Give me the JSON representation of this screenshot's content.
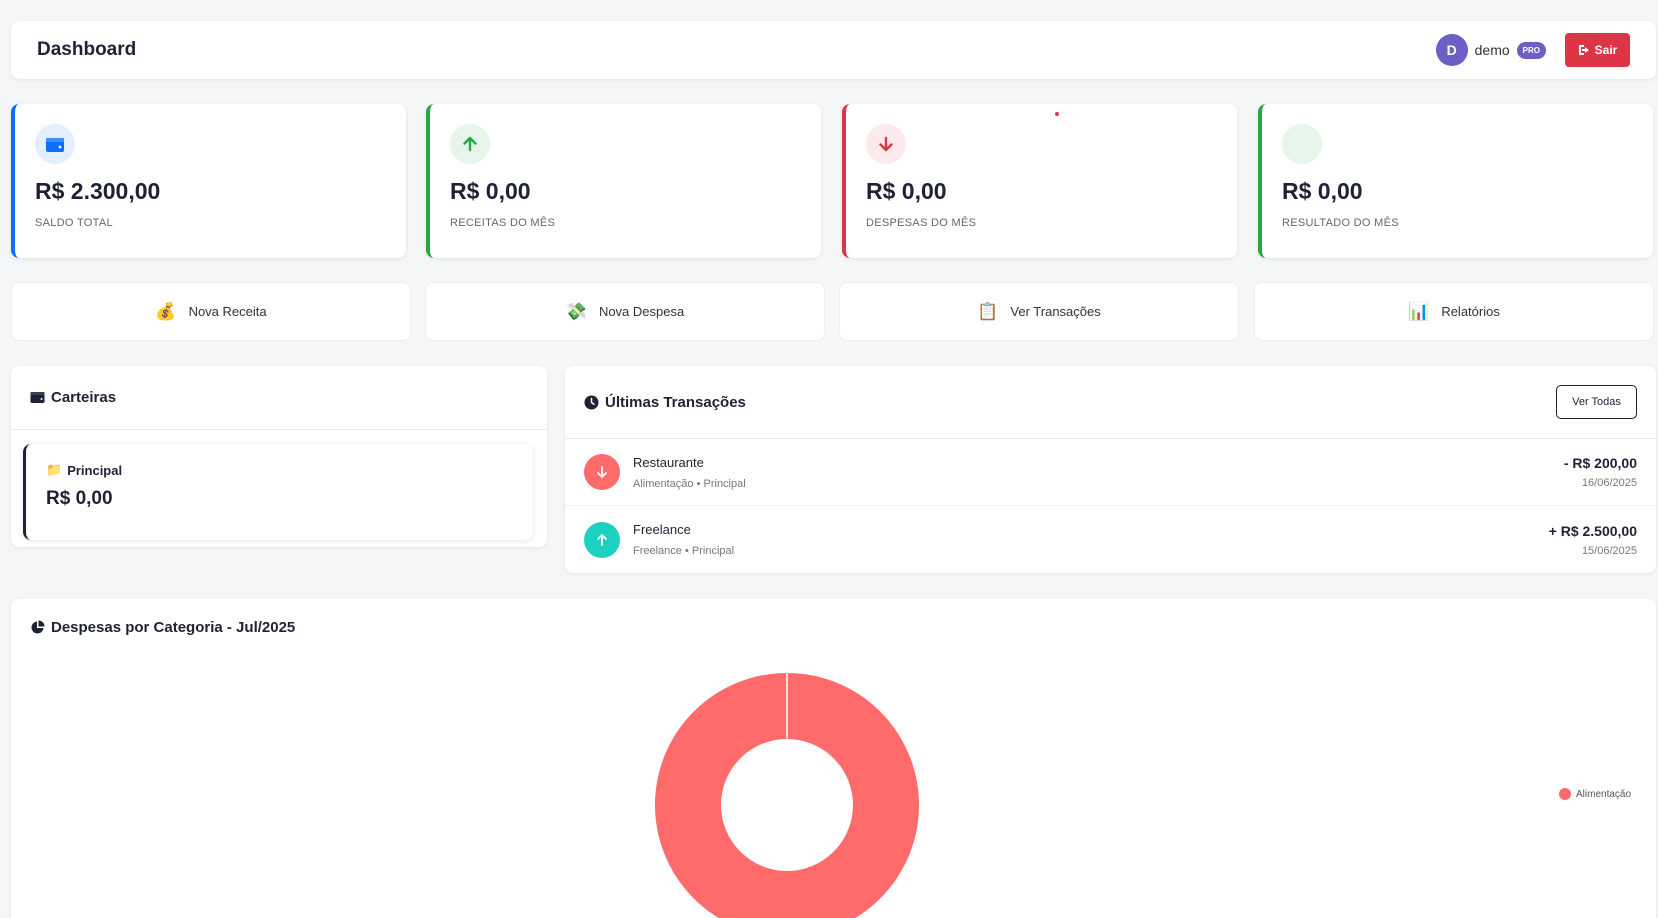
{
  "header": {
    "title": "Dashboard",
    "avatar_letter": "D",
    "username": "demo",
    "badge": "PRO",
    "logout_label": "Sair"
  },
  "stats": [
    {
      "value": "R$ 2.300,00",
      "label": "SALDO TOTAL",
      "icon": "wallet-icon",
      "accent": "#0d6efd"
    },
    {
      "value": "R$ 0,00",
      "label": "RECEITAS DO MÊS",
      "icon": "arrow-up-icon",
      "accent": "#28a745"
    },
    {
      "value": "R$ 0,00",
      "label": "DESPESAS DO MÊS",
      "icon": "arrow-down-icon",
      "accent": "#dc3545"
    },
    {
      "value": "R$ 0,00",
      "label": "RESULTADO DO MÊS",
      "icon": "",
      "accent": "#28a745"
    }
  ],
  "actions": [
    {
      "label": "Nova Receita",
      "icon": "💰"
    },
    {
      "label": "Nova Despesa",
      "icon": "💸"
    },
    {
      "label": "Ver Transações",
      "icon": "📋"
    },
    {
      "label": "Relatórios",
      "icon": "📊"
    }
  ],
  "wallets": {
    "title": "Carteiras",
    "items": [
      {
        "name": "Principal",
        "icon": "📁",
        "balance": "R$ 0,00"
      }
    ]
  },
  "transactions": {
    "title": "Últimas Transações",
    "view_all_label": "Ver Todas",
    "items": [
      {
        "description": "Restaurante",
        "meta": "Alimentação • Principal",
        "amount": "- R$ 200,00",
        "date": "16/06/2025",
        "type": "expense"
      },
      {
        "description": "Freelance",
        "meta": "Freelance • Principal",
        "amount": "+ R$ 2.500,00",
        "date": "15/06/2025",
        "type": "income"
      }
    ]
  },
  "chart_data": {
    "type": "pie",
    "title": "Despesas por Categoria - Jul/2025",
    "categories": [
      "Alimentação"
    ],
    "values": [
      100
    ],
    "colors": [
      "#ff6b6b"
    ],
    "legend_position": "right"
  }
}
